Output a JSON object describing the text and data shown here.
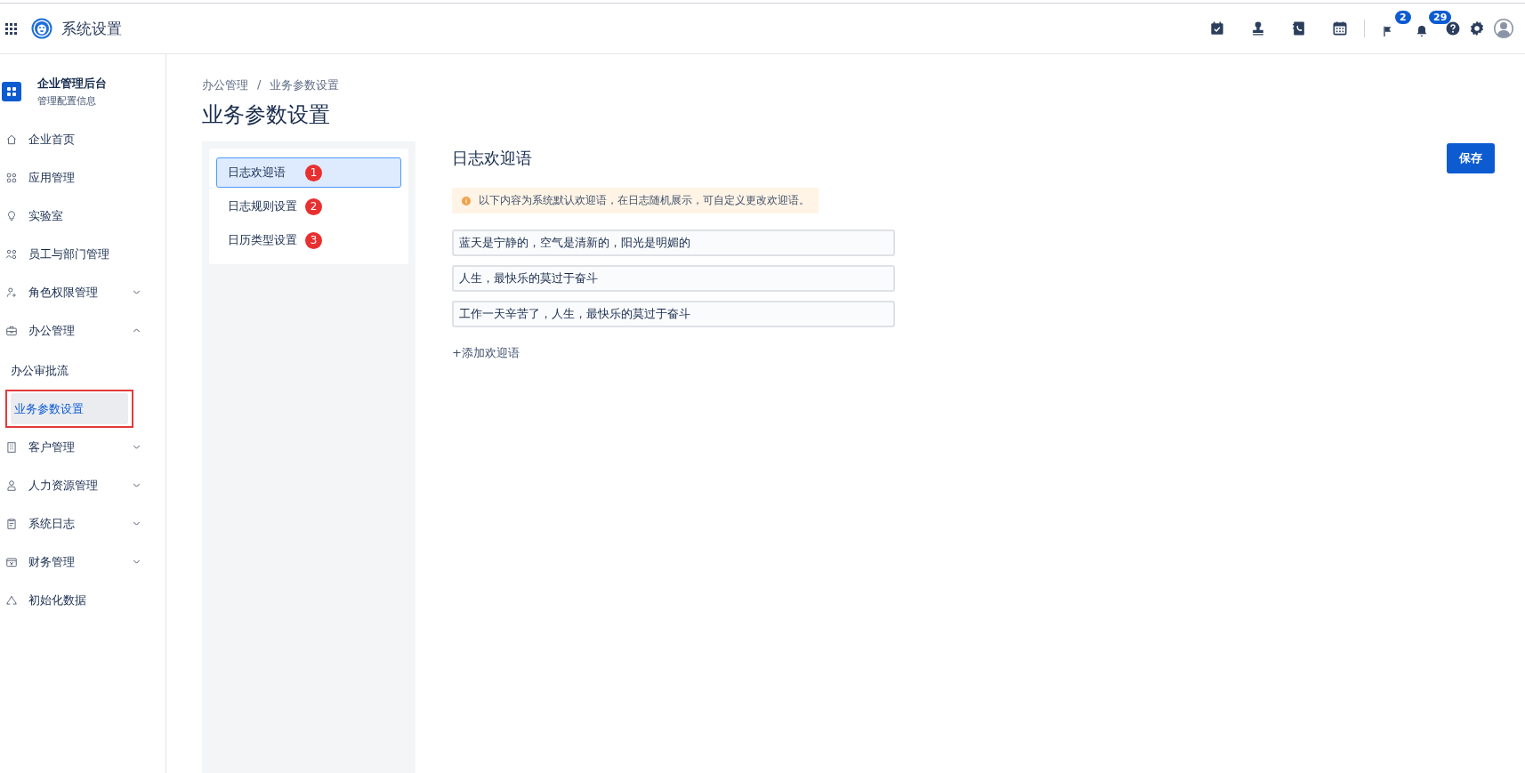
{
  "header": {
    "title": "系统设置",
    "badges": [
      {
        "count": "2"
      },
      {
        "count": "29"
      }
    ]
  },
  "sidebar": {
    "title": "企业管理后台",
    "subtitle": "管理配置信息",
    "items": [
      {
        "label": "企业首页"
      },
      {
        "label": "应用管理"
      },
      {
        "label": "实验室"
      },
      {
        "label": "员工与部门管理"
      },
      {
        "label": "角色权限管理",
        "expanded": false
      },
      {
        "label": "办公管理",
        "expanded": true,
        "children": [
          {
            "label": "办公审批流",
            "selected": false
          },
          {
            "label": "业务参数设置",
            "selected": true,
            "highlighted": true
          }
        ]
      },
      {
        "label": "客户管理",
        "expanded": false
      },
      {
        "label": "人力资源管理",
        "expanded": false
      },
      {
        "label": "系统日志",
        "expanded": false
      },
      {
        "label": "财务管理",
        "expanded": false
      },
      {
        "label": "初始化数据"
      }
    ]
  },
  "breadcrumb": [
    "办公管理",
    "/",
    "业务参数设置"
  ],
  "page_title": "业务参数设置",
  "settings_menu": [
    {
      "label": "日志欢迎语",
      "selected": true,
      "marker": "1"
    },
    {
      "label": "日志规则设置",
      "selected": false,
      "marker": "2"
    },
    {
      "label": "日历类型设置",
      "selected": false,
      "marker": "3"
    }
  ],
  "section": {
    "title": "日志欢迎语",
    "save_button": "保存",
    "notice": "以下内容为系统默认欢迎语，在日志随机展示，可自定义更改欢迎语。",
    "greetings": [
      "蓝天是宁静的，空气是清新的，阳光是明媚的",
      "人生，最快乐的莫过于奋斗",
      "工作一天辛苦了，人生，最快乐的莫过于奋斗"
    ],
    "add_link": "+添加欢迎语"
  }
}
